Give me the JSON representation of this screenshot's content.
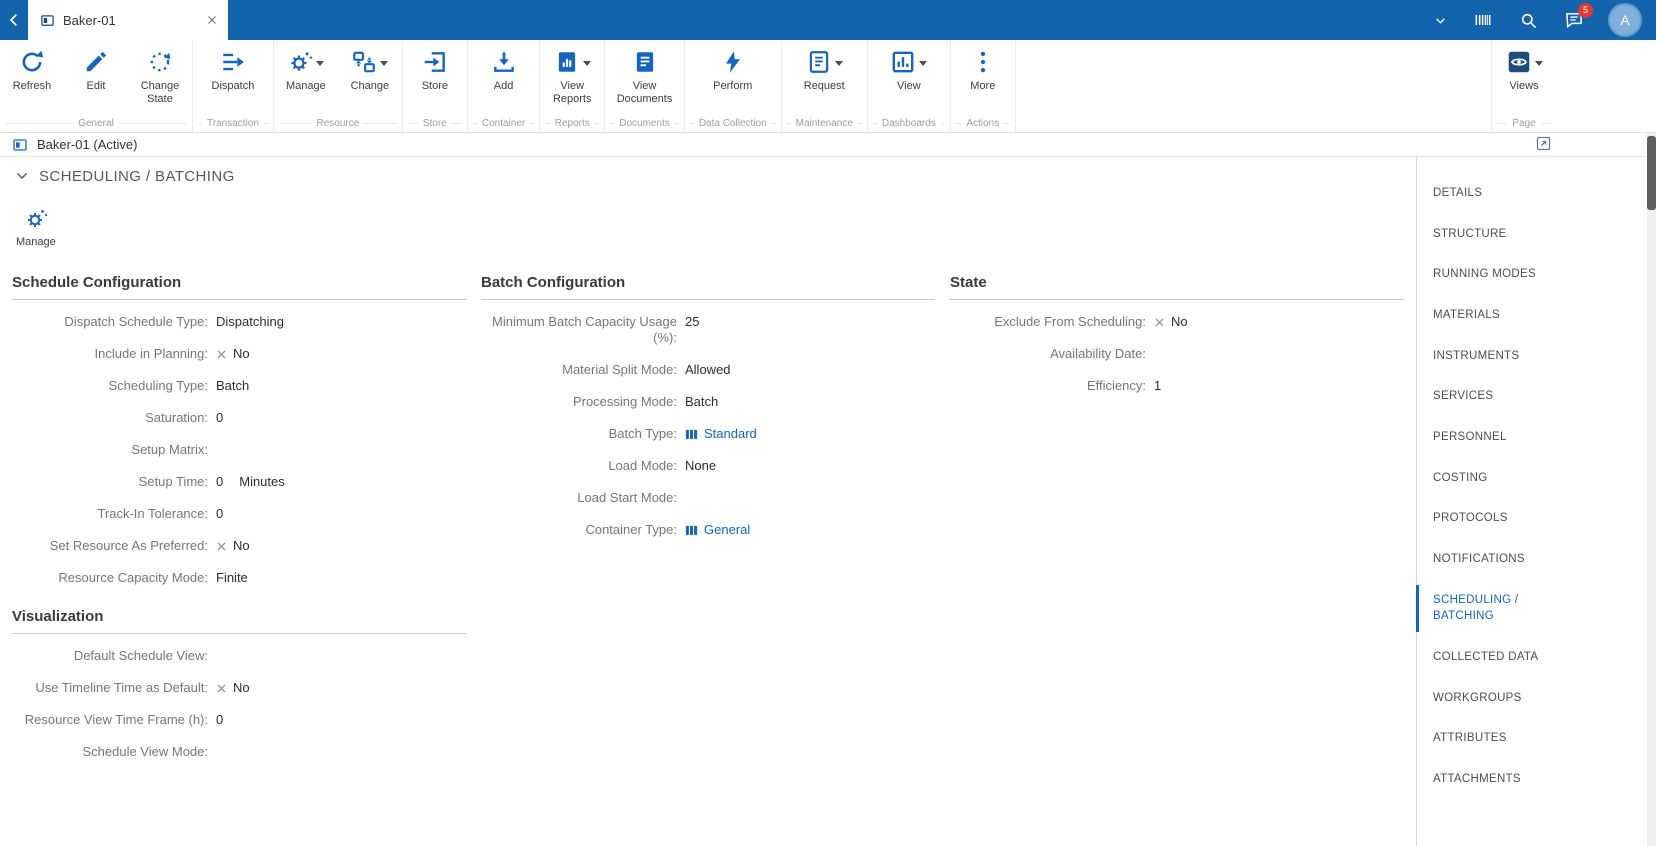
{
  "topbar": {
    "tab_title": "Baker-01",
    "badge_count": "5",
    "avatar_initial": "A"
  },
  "toolbar": {
    "groups": [
      {
        "label": "General",
        "buttons": [
          {
            "label": "Refresh"
          },
          {
            "label": "Edit"
          },
          {
            "label": "Change State"
          }
        ]
      },
      {
        "label": "Transaction",
        "buttons": [
          {
            "label": "Dispatch"
          }
        ]
      },
      {
        "label": "Resource",
        "buttons": [
          {
            "label": "Manage",
            "dropdown": true
          },
          {
            "label": "Change",
            "dropdown": true
          }
        ]
      },
      {
        "label": "Store",
        "buttons": [
          {
            "label": "Store"
          }
        ]
      },
      {
        "label": "Container",
        "buttons": [
          {
            "label": "Add"
          }
        ]
      },
      {
        "label": "Reports",
        "buttons": [
          {
            "label": "View Reports",
            "dropdown": true
          }
        ]
      },
      {
        "label": "Documents",
        "buttons": [
          {
            "label": "View Documents"
          }
        ]
      },
      {
        "label": "Data Collection",
        "buttons": [
          {
            "label": "Perform"
          }
        ]
      },
      {
        "label": "Maintenance",
        "buttons": [
          {
            "label": "Request",
            "dropdown": true
          }
        ]
      },
      {
        "label": "Dashboards",
        "buttons": [
          {
            "label": "View",
            "dropdown": true
          }
        ]
      },
      {
        "label": "Actions",
        "buttons": [
          {
            "label": "More"
          }
        ]
      }
    ],
    "page_group": {
      "label": "Page",
      "button": {
        "label": "Views",
        "dropdown": true
      }
    }
  },
  "entity_bar": {
    "title": "Baker-01 (Active)"
  },
  "section": {
    "title": "SCHEDULING / BATCHING"
  },
  "manage_button": {
    "label": "Manage"
  },
  "panels": {
    "schedule": {
      "title": "Schedule Configuration",
      "fields": [
        {
          "label": "Dispatch Schedule Type:",
          "value": "Dispatching"
        },
        {
          "label": "Include in Planning:",
          "value": "No",
          "icon": "x"
        },
        {
          "label": "Scheduling Type:",
          "value": "Batch"
        },
        {
          "label": "Saturation:",
          "value": "0"
        },
        {
          "label": "Setup Matrix:",
          "value": ""
        },
        {
          "label": "Setup Time:",
          "value": "0",
          "suffix": "Minutes"
        },
        {
          "label": "Track-In Tolerance:",
          "value": "0"
        },
        {
          "label": "Set Resource As Preferred:",
          "value": "No",
          "icon": "x"
        },
        {
          "label": "Resource Capacity Mode:",
          "value": "Finite"
        }
      ]
    },
    "batch": {
      "title": "Batch Configuration",
      "fields": [
        {
          "label": "Minimum Batch Capacity Usage (%):",
          "value": "25"
        },
        {
          "label": "Material Split Mode:",
          "value": "Allowed"
        },
        {
          "label": "Processing Mode:",
          "value": "Batch"
        },
        {
          "label": "Batch Type:",
          "value": "Standard",
          "icon": "link"
        },
        {
          "label": "Load Mode:",
          "value": "None"
        },
        {
          "label": "Load Start Mode:",
          "value": ""
        },
        {
          "label": "Container Type:",
          "value": "General",
          "icon": "link"
        }
      ]
    },
    "state": {
      "title": "State",
      "fields": [
        {
          "label": "Exclude From Scheduling:",
          "value": "No",
          "icon": "x"
        },
        {
          "label": "Availability Date:",
          "value": ""
        },
        {
          "label": "Efficiency:",
          "value": "1"
        }
      ]
    },
    "visualization": {
      "title": "Visualization",
      "fields": [
        {
          "label": "Default Schedule View:",
          "value": ""
        },
        {
          "label": "Use Timeline Time as Default:",
          "value": "No",
          "icon": "x"
        },
        {
          "label": "Resource View Time Frame (h):",
          "value": "0"
        },
        {
          "label": "Schedule View Mode:",
          "value": ""
        }
      ]
    }
  },
  "sidebar": {
    "items": [
      {
        "label": "DETAILS"
      },
      {
        "label": "STRUCTURE"
      },
      {
        "label": "RUNNING MODES"
      },
      {
        "label": "MATERIALS"
      },
      {
        "label": "INSTRUMENTS"
      },
      {
        "label": "SERVICES"
      },
      {
        "label": "PERSONNEL"
      },
      {
        "label": "COSTING"
      },
      {
        "label": "PROTOCOLS"
      },
      {
        "label": "NOTIFICATIONS"
      },
      {
        "label": "SCHEDULING / BATCHING",
        "active": true
      },
      {
        "label": "COLLECTED DATA"
      },
      {
        "label": "WORKGROUPS"
      },
      {
        "label": "ATTRIBUTES"
      },
      {
        "label": "ATTACHMENTS"
      }
    ]
  },
  "colors": {
    "topbar": "#1464AD",
    "accent": "#1565C0",
    "badge": "#E53935"
  }
}
